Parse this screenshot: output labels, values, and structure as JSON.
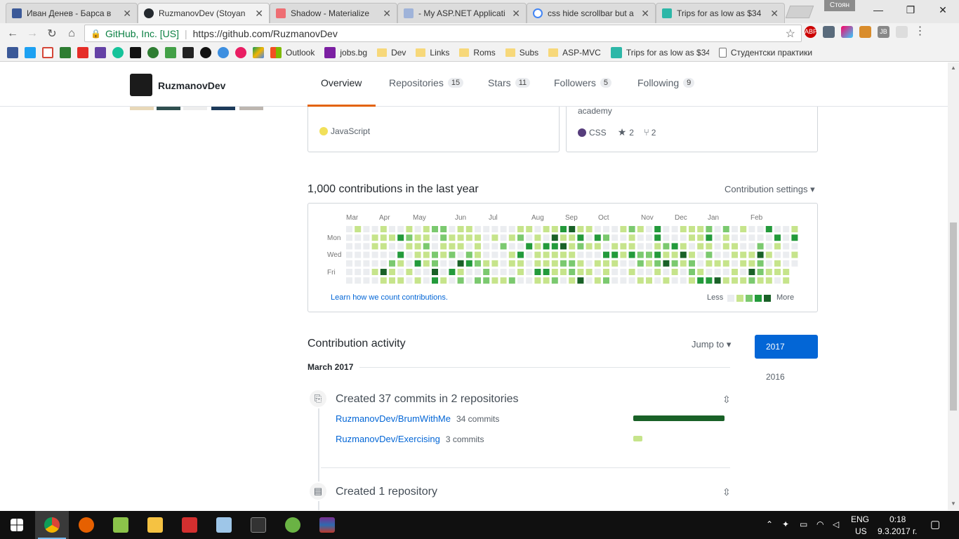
{
  "browser": {
    "tabs": [
      {
        "title": "Иван Денев - Барса в",
        "favicon_color": "#3b5998",
        "active": false
      },
      {
        "title": "RuzmanovDev (Stoyan",
        "favicon_color": "#24292e",
        "active": true
      },
      {
        "title": "Shadow - Materialize",
        "favicon_color": "#ee6e73",
        "active": false
      },
      {
        "title": "- My ASP.NET Applicati",
        "favicon_color": "#9fb3d9",
        "active": false
      },
      {
        "title": "css hide scrollbar but a",
        "favicon_color": "#4285f4",
        "active": false
      },
      {
        "title": "Trips for as low as $34",
        "favicon_color": "#2db7a8",
        "active": false
      }
    ],
    "profile_name": "Стоян",
    "address": {
      "security_label": "GitHub, Inc. [US]",
      "url": "https://github.com/RuzmanovDev"
    },
    "bookmarks": [
      {
        "label": "Outlook",
        "icon_color": "#f25022"
      },
      {
        "label": "jobs.bg",
        "icon_color": "#7b1fa2"
      },
      {
        "label": "Dev",
        "icon_color": "#f7d87a"
      },
      {
        "label": "Links",
        "icon_color": "#f7d87a"
      },
      {
        "label": "Roms",
        "icon_color": "#f7d87a"
      },
      {
        "label": "Subs",
        "icon_color": "#f7d87a"
      },
      {
        "label": "ASP-MVC",
        "icon_color": "#f7d87a"
      },
      {
        "label": "Trips for as low as $34",
        "icon_color": "#2db7a8"
      },
      {
        "label": "Студентски практики",
        "icon_color": "#777777"
      }
    ]
  },
  "profile": {
    "username": "RuzmanovDev",
    "tabs": [
      {
        "label": "Overview",
        "count": ""
      },
      {
        "label": "Repositories",
        "count": "15"
      },
      {
        "label": "Stars",
        "count": "11"
      },
      {
        "label": "Followers",
        "count": "5"
      },
      {
        "label": "Following",
        "count": "9"
      }
    ]
  },
  "pinned": [
    {
      "description": "",
      "language": "JavaScript",
      "language_color": "#f1e05a",
      "stars": "",
      "forks": ""
    },
    {
      "description": "academy",
      "language": "CSS",
      "language_color": "#563d7c",
      "stars": "2",
      "forks": "2"
    }
  ],
  "contributions": {
    "title": "1,000 contributions in the last year",
    "settings_label": "Contribution settings ▾",
    "months": [
      "Mar",
      "Apr",
      "May",
      "Jun",
      "Jul",
      "Aug",
      "Sep",
      "Oct",
      "Nov",
      "Dec",
      "Jan",
      "Feb"
    ],
    "days": [
      "Mon",
      "Wed",
      "Fri"
    ],
    "learn_link": "Learn how we count contributions.",
    "legend_less": "Less",
    "legend_more": "More",
    "colors": [
      "#ebedf0",
      "#c6e48b",
      "#7bc96f",
      "#239a3b",
      "#196127"
    ]
  },
  "activity": {
    "title": "Contribution activity",
    "jump_to": "Jump to ▾",
    "years": [
      "2017",
      "2016"
    ],
    "month": "March 2017",
    "events": [
      {
        "title": "Created 37 commits in 2 repositories",
        "repos": [
          {
            "name": "RuzmanovDev/BrumWithMe",
            "count": "34 commits",
            "share": 1.0,
            "color": "#196127"
          },
          {
            "name": "RuzmanovDev/Exercising",
            "count": "3 commits",
            "share": 0.1,
            "color": "#c6e48b"
          }
        ]
      },
      {
        "title": "Created 1 repository",
        "repos": []
      }
    ]
  },
  "taskbar": {
    "apps": [
      {
        "name": "chrome",
        "color": "#e8b100",
        "open": true
      },
      {
        "name": "firefox",
        "color": "#e66000",
        "open": false
      },
      {
        "name": "notepad-plus",
        "color": "#8bc34a",
        "open": false
      },
      {
        "name": "explorer",
        "color": "#f5c242",
        "open": false
      },
      {
        "name": "adobe-flash",
        "color": "#d32f2f",
        "open": false
      },
      {
        "name": "control-panel",
        "color": "#9ec6e8",
        "open": false
      },
      {
        "name": "terminal",
        "color": "#444444",
        "open": false
      },
      {
        "name": "utorrent",
        "color": "#6ab344",
        "open": false
      },
      {
        "name": "winrar",
        "color": "#7b2d8e",
        "open": false
      }
    ],
    "language": "ENG",
    "layout": "US",
    "time": "0:18",
    "date": "9.3.2017 г."
  }
}
